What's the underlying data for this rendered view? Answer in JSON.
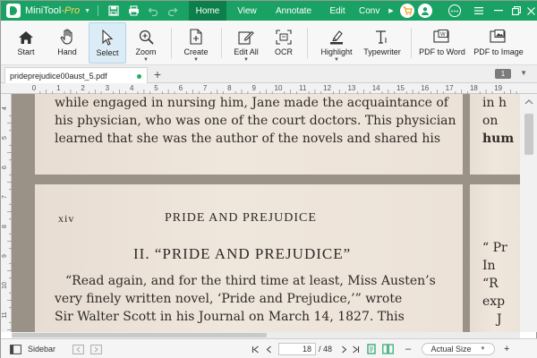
{
  "app": {
    "name": "MiniTool",
    "edition": "-Pro",
    "accent_color": "#1aa264"
  },
  "menu": {
    "items": [
      {
        "label": "Home",
        "active": true
      },
      {
        "label": "View"
      },
      {
        "label": "Annotate"
      },
      {
        "label": "Edit"
      },
      {
        "label": "Conv"
      }
    ]
  },
  "toolbar": {
    "start": "Start",
    "hand": "Hand",
    "select": "Select",
    "zoom": "Zoom",
    "create": "Create",
    "edit_all": "Edit All",
    "ocr": "OCR",
    "highlight": "Highlight",
    "typewriter": "Typewriter",
    "pdf_to_word": "PDF to Word",
    "pdf_to_image": "PDF to Image"
  },
  "tabs": {
    "file_name": "prideprejudice00aust_5.pdf",
    "page_badge": "1"
  },
  "ruler": {
    "numbers": [
      "0",
      "1",
      "2",
      "3",
      "4",
      "5",
      "6",
      "7",
      "8",
      "9",
      "10",
      "11",
      "12",
      "13",
      "14",
      "15",
      "16",
      "17",
      "18",
      "19"
    ],
    "vnumbers": [
      "4",
      "5",
      "6",
      "7",
      "8",
      "9",
      "10",
      "11"
    ]
  },
  "document": {
    "page1_lines": [
      "while engaged in nursing him, Jane made the acquaintance of",
      "his physician, who was one of the court doctors. This physician",
      "learned that she was the author of the novels and shared his"
    ],
    "page2_folio": "xiv",
    "page2_running_head": "PRIDE AND PREJUDICE",
    "page2_heading": "II. “PRIDE AND PREJUDICE”",
    "page2_lines": [
      "“Read again, and for the third time at least, Miss Austen’s",
      "very finely written novel, ‘Pride and Prejudice,’” wrote",
      "Sir Walter Scott in his Journal on March 14, 1827. This"
    ],
    "right_top_lines": [
      "in h",
      "on",
      "hum"
    ],
    "right_bottom_lines": [
      "“ Pr",
      "In",
      "“R",
      "exp",
      "J"
    ]
  },
  "statusbar": {
    "sidebar": "Sidebar",
    "current_page": "18",
    "total_pages": "/ 48",
    "zoom": "Actual Size"
  }
}
